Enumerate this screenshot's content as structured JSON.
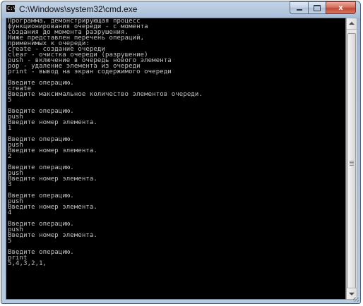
{
  "window": {
    "title": "C:\\Windows\\system32\\cmd.exe",
    "icon": "console-window-icon",
    "icon_glyph": "C:\\"
  },
  "controls": {
    "minimize_icon": "minimize-icon",
    "maximize_icon": "maximize-icon",
    "close_label": "x"
  },
  "console": {
    "lines": [
      "Программа, демонстрирующая процесс",
      "функционирования очереди - с момента",
      "создания до момента разрушения.",
      "Ниже представлен перечень операций,",
      "применимых к очереди:",
      "create - создание очереди",
      "clear - очистка очереди (разрушение)",
      "push - включение в очередь нового элемента",
      "pop - удаление элемента из очереди",
      "print - вывод на экран содержимого очереди",
      "",
      "Введите операцию.",
      "create",
      "Введите максимальное количество элементов очереди.",
      "5",
      "",
      "Введите операцию.",
      "push",
      "Введите номер элемента.",
      "1",
      "",
      "Введите операцию.",
      "push",
      "Введите номер элемента.",
      "2",
      "",
      "Введите операцию.",
      "push",
      "Введите номер элемента.",
      "3",
      "",
      "Введите операцию.",
      "push",
      "Введите номер элемента.",
      "4",
      "",
      "Введите операцию.",
      "push",
      "Введите номер элемента.",
      "5",
      "",
      "Введите операцию.",
      "print",
      "5,4,3,2,1,",
      "",
      "",
      "",
      ""
    ]
  }
}
